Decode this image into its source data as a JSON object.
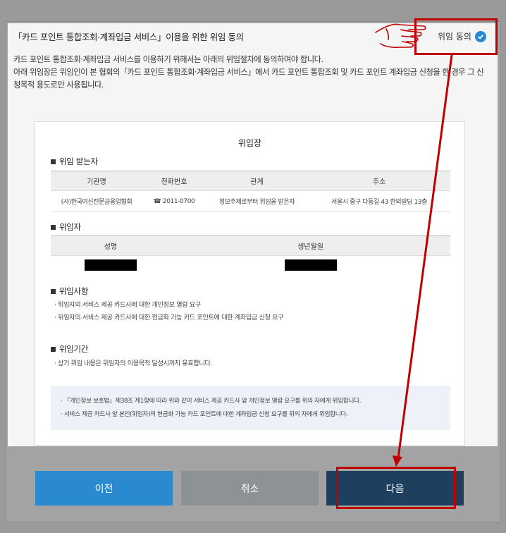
{
  "dialog": {
    "title": "「카드 포인트 통합조회·계좌입금 서비스」이용을 위한 위임 동의",
    "agree_label": "위임 동의",
    "desc_line1": "카드 포인트 통합조회·계좌입금 서비스를 이용하기 위해서는 아래의 위임절차에 동의하여야 합니다.",
    "desc_line2": "아래 위임장은 위임인이 본 협회의「카드 포인트 통합조회·계좌입금 서비스」에서 카드 포인트 통합조회 및 카드 포인트 계좌입금 신청을 한 경우 그 신청목적 용도로만 사용됩니다."
  },
  "card": {
    "title": "위임장",
    "section_delegate": "위임 받는자",
    "delegate_headers": [
      "기관명",
      "전화번호",
      "관계",
      "주소"
    ],
    "delegate_row": [
      "(사)한국여신전문금융업협회",
      "☎ 2011-0700",
      "정보주체로부터 위임을 받은자",
      "서울시 중구 다동길 43 한외빌딩 13층"
    ],
    "section_principal": "위임자",
    "principal_headers": [
      "성명",
      "생년월일"
    ],
    "section_matters": "위임사항",
    "matters": [
      "· 위임자의 서비스 제공 카드사에 대한 개인정보 열람 요구",
      "· 위임자의 서비스 제공 카드사에 대한 현금화 가능 카드 포인트에 대한 계좌입금 신청 요구"
    ],
    "section_period": "위임기간",
    "period": "· 상기 위임 내용은 위임자의 이용목적 달성시까지 유효합니다.",
    "notice": [
      "· 「개인정보 보호법」제38조 제1항에 따라 위와 같이 서비스 제공 카드사 앞 개인정보 열람 요구를 위의 자에게 위임합니다.",
      "· 서비스 제공 카드사 앞 본인(위임자)의 현금화 가능 카드 포인트에 대한 계좌입금 신청 요구를 위의 자에게 위임합니다."
    ]
  },
  "buttons": {
    "prev": "이전",
    "cancel": "취소",
    "next": "다음"
  },
  "colors": {
    "primary_blue": "#2a8ad0",
    "cancel_gray": "#8d9295",
    "next_navy": "#1f3f5f",
    "highlight_red": "#c00000"
  }
}
